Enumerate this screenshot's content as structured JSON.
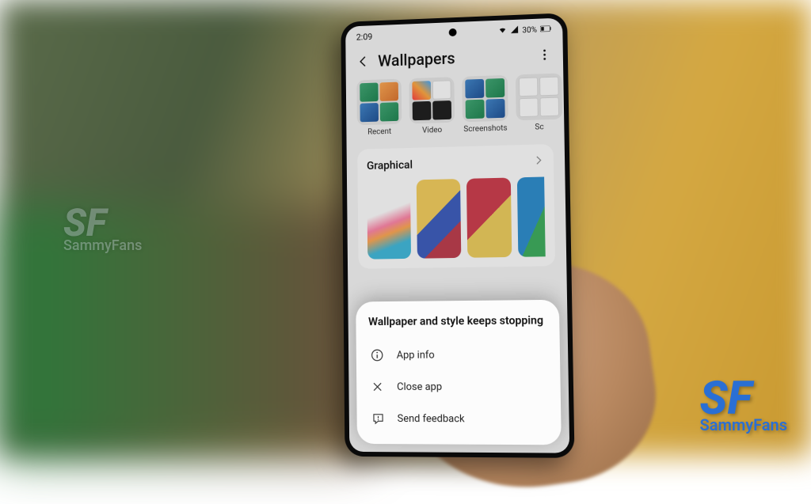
{
  "watermark": {
    "brand": "SF",
    "name": "SammyFans"
  },
  "status": {
    "time": "2:09",
    "battery": "30%"
  },
  "header": {
    "title": "Wallpapers"
  },
  "folders": [
    {
      "label": "Recent"
    },
    {
      "label": "Video"
    },
    {
      "label": "Screenshots"
    },
    {
      "label": "Sc"
    }
  ],
  "section": {
    "title": "Graphical"
  },
  "dialog": {
    "title": "Wallpaper and style keeps stopping",
    "app_info": "App info",
    "close_app": "Close app",
    "send_feedback": "Send feedback"
  }
}
